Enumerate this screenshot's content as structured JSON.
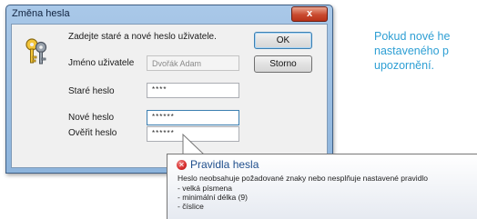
{
  "dialog": {
    "title": "Změna hesla",
    "close_label": "x",
    "prompt": "Zadejte staré a nové heslo uživatele.",
    "fields": [
      {
        "label": "Jméno uživatele",
        "value": "Dvořák Adam"
      },
      {
        "label": "Staré heslo",
        "value": "****"
      },
      {
        "label": "Nové heslo",
        "value": "******"
      },
      {
        "label": "Ověřit heslo",
        "value": "******"
      }
    ],
    "buttons": {
      "ok": "OK",
      "cancel": "Storno"
    }
  },
  "note": {
    "lines": [
      "Pokud nové he",
      "nastaveného p",
      "upozornění."
    ],
    "color": "#2e9fd4"
  },
  "balloon": {
    "title": "Pravidla hesla",
    "message": "Heslo neobsahuje požadované znaky nebo nesplňuje nastavené pravidlo",
    "rules": [
      "- velká písmena",
      "- minimální délka (9)",
      "- číslice"
    ],
    "icon": "error-icon"
  }
}
